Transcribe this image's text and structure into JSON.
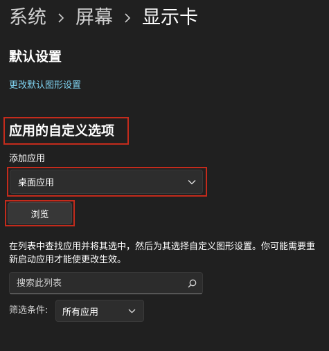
{
  "breadcrumb": {
    "items": [
      "系统",
      "屏幕",
      "显示卡"
    ]
  },
  "default_settings": {
    "title": "默认设置",
    "link": "更改默认图形设置"
  },
  "custom_options": {
    "title": "应用的自定义选项",
    "add_app_label": "添加应用",
    "app_type_selected": "桌面应用",
    "browse_label": "浏览",
    "description": "在列表中查找应用并将其选中，然后为其选择自定义图形设置。你可能需要重新启动应用才能使更改生效。",
    "search_placeholder": "搜索此列表",
    "filter_label": "筛选条件:",
    "filter_selected": "所有应用"
  },
  "colors": {
    "background": "#202020",
    "link": "#7fd2f0",
    "highlight": "#c42b1c"
  },
  "icons": {
    "separator": "chevron-right-icon",
    "dropdown": "chevron-down-icon",
    "search": "search-icon"
  }
}
